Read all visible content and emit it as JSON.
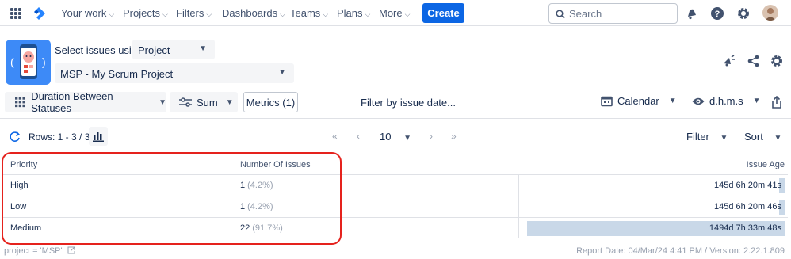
{
  "topnav": {
    "items": [
      {
        "label": "Your work"
      },
      {
        "label": "Projects"
      },
      {
        "label": "Filters"
      },
      {
        "label": "Dashboards"
      },
      {
        "label": "Teams"
      },
      {
        "label": "Plans"
      },
      {
        "label": "More"
      }
    ],
    "create_label": "Create",
    "search_placeholder": "Search",
    "accent": "#0c66e4"
  },
  "header": {
    "select_label": "Select issues using",
    "source_value": "Project",
    "project_value": "MSP - My Scrum Project"
  },
  "toolbar": {
    "report_type": "Duration Between Statuses",
    "aggregation": "Sum",
    "metrics": "Metrics (1)",
    "filter_date": "Filter by issue date...",
    "calendar": "Calendar",
    "format": "d.h.m.s"
  },
  "rowsbar": {
    "rows_text": "Rows: 1 - 3 / 3",
    "page_size": "10",
    "filter_label": "Filter",
    "sort_label": "Sort"
  },
  "table": {
    "columns": [
      "Priority",
      "Number Of Issues",
      "Issue Age"
    ],
    "rows": [
      {
        "priority": "High",
        "count": "1",
        "pct": "(4.2%)",
        "age": "145d 6h 20m 41s",
        "bar_fraction": 0.02
      },
      {
        "priority": "Low",
        "count": "1",
        "pct": "(4.2%)",
        "age": "145d 6h 20m 46s",
        "bar_fraction": 0.02
      },
      {
        "priority": "Medium",
        "count": "22",
        "pct": "(91.7%)",
        "age": "1494d 7h 33m 48s",
        "bar_fraction": 0.98
      }
    ]
  },
  "footer": {
    "query": "project = 'MSP'",
    "report_info": "Report Date: 04/Mar/24 4:41 PM / Version: 2.22.1.809"
  },
  "colors": {
    "highlight": "#e5221d",
    "bar": "#c9d8e8"
  }
}
